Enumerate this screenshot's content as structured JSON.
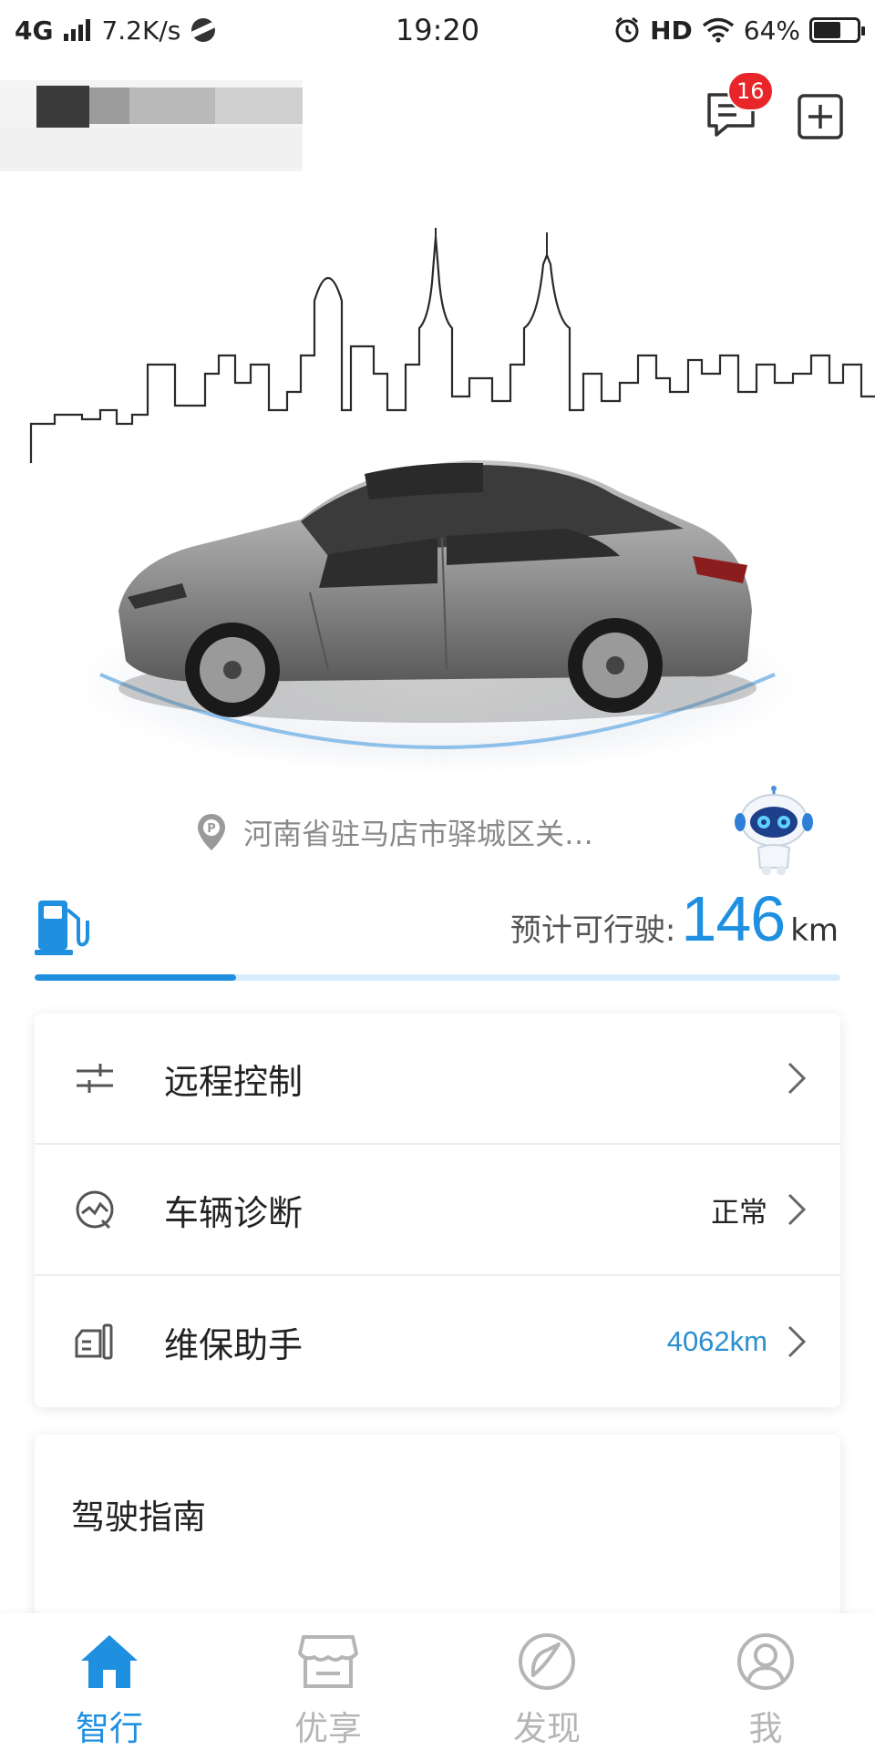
{
  "status_bar": {
    "network": "4G",
    "speed": "7.2K/s",
    "time": "19:20",
    "hd": "HD",
    "battery": "64%",
    "battery_level": 0.64
  },
  "header": {
    "badge_count": "16",
    "message_icon": "message-icon",
    "add_icon": "plus-square-icon"
  },
  "location": {
    "text": "河南省驻马店市驿城区关…",
    "icon": "parking-pin-icon"
  },
  "fuel": {
    "icon": "fuel-pump-icon",
    "label": "预计可行驶:",
    "value": "146",
    "unit": "km",
    "level": 0.25
  },
  "menu": [
    {
      "label": "远程控制",
      "value": "",
      "icon": "sliders-icon"
    },
    {
      "label": "车辆诊断",
      "value": "正常",
      "icon": "diagnosis-gauge-icon"
    },
    {
      "label": "维保助手",
      "value": "4062km",
      "icon": "maintenance-icon"
    }
  ],
  "guide": {
    "title": "驾驶指南"
  },
  "nav": [
    {
      "label": "智行",
      "icon": "home-icon",
      "active": true
    },
    {
      "label": "优享",
      "icon": "store-icon",
      "active": false
    },
    {
      "label": "发现",
      "icon": "compass-icon",
      "active": false
    },
    {
      "label": "我",
      "icon": "user-icon",
      "active": false
    }
  ],
  "colors": {
    "accent": "#1f8fe0",
    "badge": "#e8262a",
    "muted": "#b5b5b5"
  }
}
